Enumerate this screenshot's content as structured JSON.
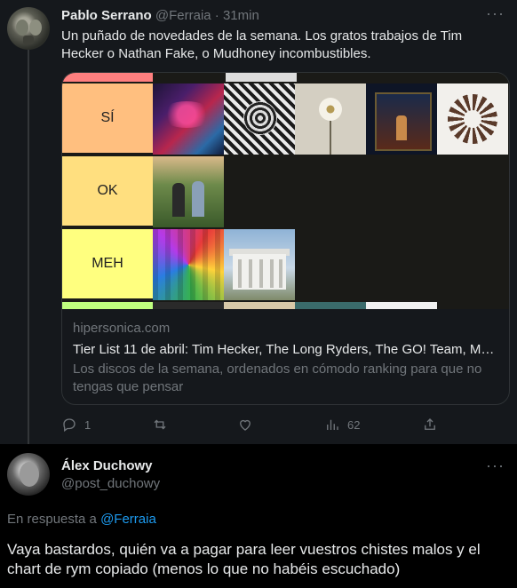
{
  "tweet": {
    "author_name": "Pablo Serrano",
    "author_handle": "@Ferraia",
    "separator": "·",
    "time": "31min",
    "more_label": "···",
    "text": "Un puñado de novedades de la semana. Los gratos trabajos de Tim Hecker o Nathan Fake, o Mudhoney incombustibles.",
    "card": {
      "tiers": [
        "SÍ",
        "OK",
        "MEH"
      ],
      "domain": "hipersonica.com",
      "title": "Tier List 11 de abril: Tim Hecker, The Long Ryders, The GO! Team, Mu...",
      "description": "Los discos de la semana, ordenados en cómodo ranking para que no tengas que pensar"
    },
    "actions": {
      "reply_count": "1",
      "retweet_count": "",
      "like_count": "",
      "views_count": "62"
    }
  },
  "reply_tweet": {
    "author_name": "Álex Duchowy",
    "author_handle": "@post_duchowy",
    "more_label": "···",
    "reply_prefix": "En respuesta a",
    "reply_to": "@Ferraia",
    "text": "Vaya bastardos, quién va a pagar para leer vuestros chistes malos y el chart de rym copiado (menos lo que no habéis escuchado)"
  },
  "colors": {
    "background_dark": "#15181c",
    "accent_link": "#1d9bf0",
    "muted_text": "#71767b",
    "tier_si": "#ffbf7f",
    "tier_ok": "#ffdf7f",
    "tier_meh": "#ffff7f"
  }
}
